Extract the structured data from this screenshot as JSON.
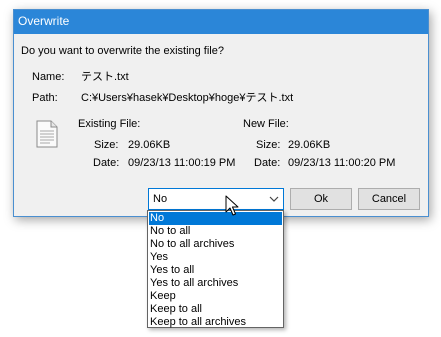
{
  "window": {
    "title": "Overwrite"
  },
  "dialog": {
    "question": "Do you want to overwrite the existing file?",
    "name_label": "Name:",
    "name_value": "テスト.txt",
    "path_label": "Path:",
    "path_value": "C:¥Users¥hasek¥Desktop¥hoge¥テスト.txt",
    "existing": {
      "heading": "Existing File:",
      "size_label": "Size:",
      "size_value": "29.06KB",
      "date_label": "Date:",
      "date_value": "09/23/13 11:00:19 PM"
    },
    "new": {
      "heading": "New File:",
      "size_label": "Size:",
      "size_value": "29.06KB",
      "date_label": "Date:",
      "date_value": "09/23/13 11:00:20 PM"
    },
    "buttons": {
      "ok": "Ok",
      "cancel": "Cancel"
    }
  },
  "dropdown": {
    "selected": "No",
    "options": [
      "No",
      "No to all",
      "No to all archives",
      "Yes",
      "Yes to all",
      "Yes to all archives",
      "Keep",
      "Keep to all",
      "Keep to all archives"
    ],
    "highlighted_index": 0
  },
  "colors": {
    "titlebar": "#2b86d8",
    "dialog_bg": "#f0f0f0",
    "selection": "#0078d7"
  },
  "icons": [
    "document-icon",
    "chevron-down-icon",
    "mouse-cursor-icon"
  ]
}
